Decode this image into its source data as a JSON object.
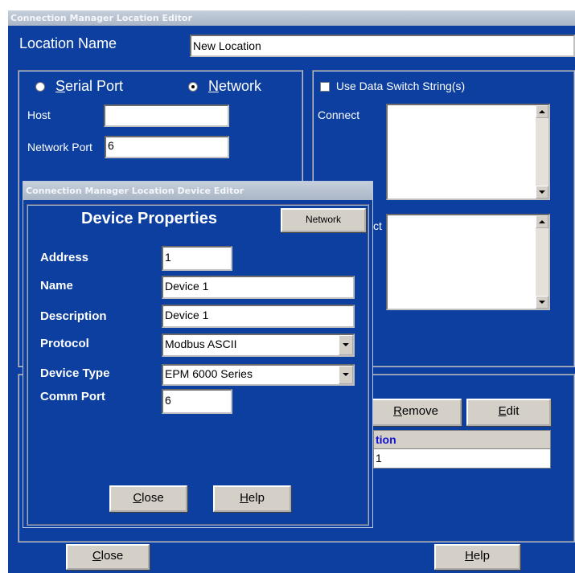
{
  "window": {
    "title": "Connection Manager Location Editor",
    "location_name_label": "Location Name",
    "location_name_value": "New Location"
  },
  "connection": {
    "serial_port_label": "Serial Port",
    "network_label": "Network",
    "selected": "Network",
    "host_label": "Host",
    "host_value": "",
    "network_port_label": "Network Port",
    "network_port_value": "6"
  },
  "data_switch": {
    "use_label": "Use Data Switch String(s)",
    "checked": false,
    "connect_label": "Connect",
    "disconnect_partial": "ct"
  },
  "device_list": {
    "remove_label": "Remove",
    "edit_label": "Edit",
    "column_partial": "tion",
    "row_partial": "1"
  },
  "footer": {
    "close_label": "Close",
    "help_label": "Help"
  },
  "device_editor": {
    "title": "Connection Manager Location Device Editor",
    "heading": "Device Properties",
    "mode_button": "Network",
    "address_label": "Address",
    "address_value": "1",
    "name_label": "Name",
    "name_value": "Device 1",
    "description_label": "Description",
    "description_value": "Device 1",
    "protocol_label": "Protocol",
    "protocol_value": "Modbus ASCII",
    "device_type_label": "Device Type",
    "device_type_value": "EPM 6000 Series",
    "comm_port_label": "Comm Port",
    "comm_port_value": "6",
    "close_label": "Close",
    "help_label": "Help"
  },
  "colors": {
    "window_bg": "#0c3fa0",
    "button_face": "#d4d0c8",
    "titlebar": "#aab6c6",
    "column_header_text": "#1010d0"
  }
}
